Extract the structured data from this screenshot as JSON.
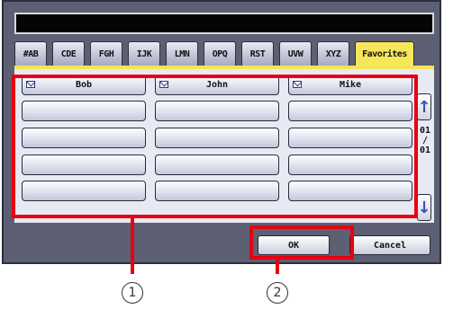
{
  "tabs": [
    {
      "label": "#AB"
    },
    {
      "label": "CDE"
    },
    {
      "label": "FGH"
    },
    {
      "label": "IJK"
    },
    {
      "label": "LMN"
    },
    {
      "label": "OPQ"
    },
    {
      "label": "RST"
    },
    {
      "label": "UVW"
    },
    {
      "label": "XYZ"
    },
    {
      "label": "Favorites"
    }
  ],
  "contacts": [
    {
      "name": "Bob"
    },
    {
      "name": "John"
    },
    {
      "name": "Mike"
    }
  ],
  "pager": {
    "current": "01",
    "separator": "/",
    "total": "01"
  },
  "buttons": {
    "ok": "OK",
    "cancel": "Cancel"
  },
  "callouts": {
    "one": "1",
    "two": "2"
  },
  "colors": {
    "panel": "#5d5f73",
    "active_tab": "#f6e65a",
    "callout": "#e60012"
  }
}
